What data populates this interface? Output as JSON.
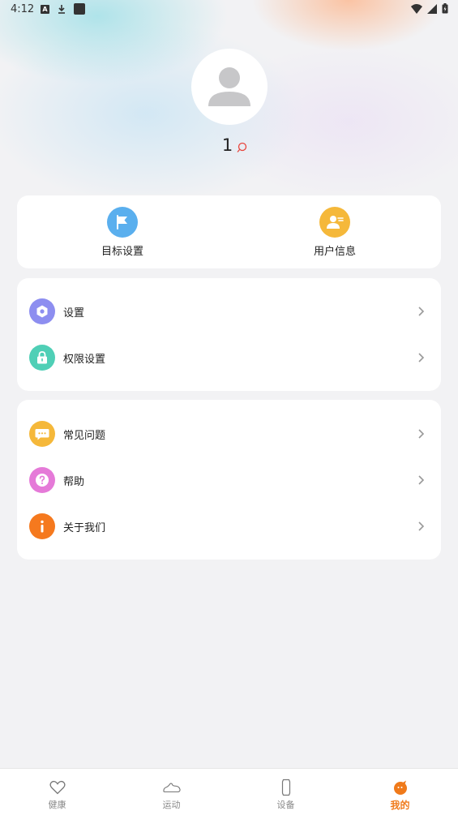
{
  "status_bar": {
    "time": "4:12"
  },
  "profile": {
    "username": "1"
  },
  "quick_actions": [
    {
      "label": "目标设置",
      "icon": "flag-icon",
      "color": "#5aafee"
    },
    {
      "label": "用户信息",
      "icon": "user-card-icon",
      "color": "#f5b83a"
    }
  ],
  "settings_section": [
    {
      "label": "设置",
      "icon": "gear-icon",
      "color": "#8d8ef0"
    },
    {
      "label": "权限设置",
      "icon": "lock-icon",
      "color": "#4fcfb6"
    }
  ],
  "help_section": [
    {
      "label": "常见问题",
      "icon": "chat-bubble-icon",
      "color": "#f5b83a"
    },
    {
      "label": "帮助",
      "icon": "question-icon",
      "color": "#e57ad8"
    },
    {
      "label": "关于我们",
      "icon": "info-icon",
      "color": "#f5791e"
    }
  ],
  "tab_bar": {
    "active": "我的",
    "accent": "#f07a1a",
    "tabs": [
      {
        "label": "健康",
        "icon": "heart-icon"
      },
      {
        "label": "运动",
        "icon": "sneaker-icon"
      },
      {
        "label": "设备",
        "icon": "watch-icon"
      },
      {
        "label": "我的",
        "icon": "mascot-icon"
      }
    ]
  }
}
